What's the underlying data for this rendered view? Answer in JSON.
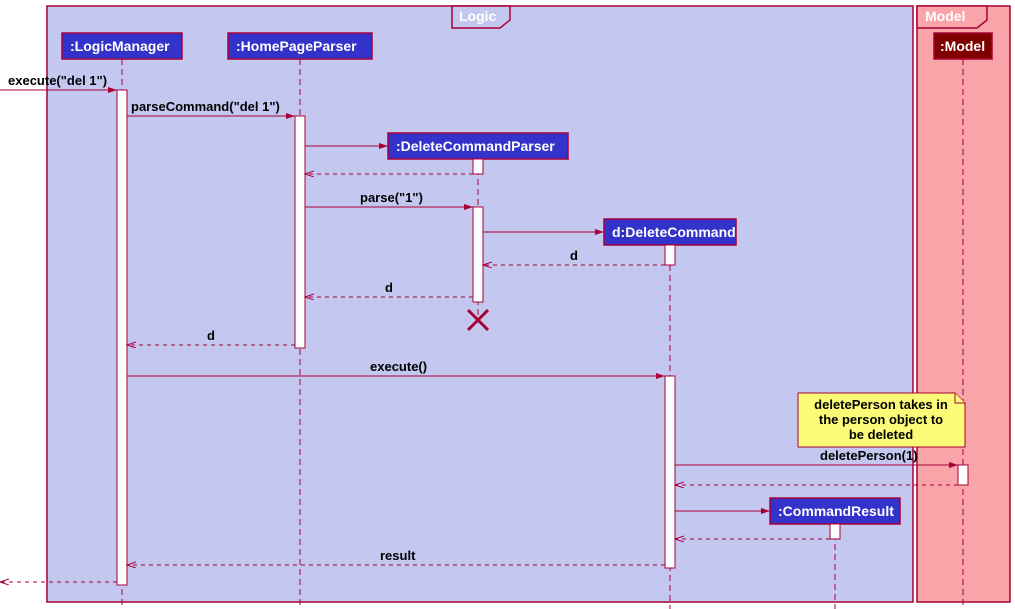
{
  "frames": {
    "logic": "Logic",
    "model": "Model"
  },
  "participants": {
    "logicManager": ":LogicManager",
    "homePageParser": ":HomePageParser",
    "deleteCommandParser": ":DeleteCommandParser",
    "deleteCommand": "d:DeleteCommand",
    "commandResult": ":CommandResult",
    "model": ":Model"
  },
  "messages": {
    "execute_in": "execute(\"del 1\")",
    "parseCommand": "parseCommand(\"del 1\")",
    "parse": "parse(\"1\")",
    "d_ret1": "d",
    "d_ret2": "d",
    "d_ret3": "d",
    "execute_call": "execute()",
    "deletePerson": "deletePerson(1)",
    "result": "result"
  },
  "note": {
    "line1": "deletePerson takes in",
    "line2": "the person object to",
    "line3": "be deleted"
  },
  "chart_data": {
    "type": "sequence-diagram",
    "frames": [
      {
        "name": "Logic",
        "contains": [
          ":LogicManager",
          ":HomePageParser",
          ":DeleteCommandParser",
          "d:DeleteCommand",
          ":CommandResult"
        ]
      },
      {
        "name": "Model",
        "contains": [
          ":Model"
        ]
      }
    ],
    "events": [
      {
        "from": "external",
        "to": ":LogicManager",
        "label": "execute(\"del 1\")",
        "type": "sync"
      },
      {
        "from": ":LogicManager",
        "to": ":HomePageParser",
        "label": "parseCommand(\"del 1\")",
        "type": "sync"
      },
      {
        "from": ":HomePageParser",
        "to": ":DeleteCommandParser",
        "label": "",
        "type": "create"
      },
      {
        "from": ":DeleteCommandParser",
        "to": ":HomePageParser",
        "label": "",
        "type": "return"
      },
      {
        "from": ":HomePageParser",
        "to": ":DeleteCommandParser",
        "label": "parse(\"1\")",
        "type": "sync"
      },
      {
        "from": ":DeleteCommandParser",
        "to": "d:DeleteCommand",
        "label": "",
        "type": "create"
      },
      {
        "from": "d:DeleteCommand",
        "to": ":DeleteCommandParser",
        "label": "d",
        "type": "return"
      },
      {
        "from": ":DeleteCommandParser",
        "to": ":HomePageParser",
        "label": "d",
        "type": "return"
      },
      {
        "type": "destroy",
        "target": ":DeleteCommandParser"
      },
      {
        "from": ":HomePageParser",
        "to": ":LogicManager",
        "label": "d",
        "type": "return"
      },
      {
        "from": ":LogicManager",
        "to": "d:DeleteCommand",
        "label": "execute()",
        "type": "sync"
      },
      {
        "type": "note",
        "attached_to": ":Model",
        "text": "deletePerson takes in the person object to be deleted"
      },
      {
        "from": "d:DeleteCommand",
        "to": ":Model",
        "label": "deletePerson(1)",
        "type": "sync"
      },
      {
        "from": ":Model",
        "to": "d:DeleteCommand",
        "label": "",
        "type": "return"
      },
      {
        "from": "d:DeleteCommand",
        "to": ":CommandResult",
        "label": "",
        "type": "create"
      },
      {
        "from": ":CommandResult",
        "to": "d:DeleteCommand",
        "label": "",
        "type": "return"
      },
      {
        "from": "d:DeleteCommand",
        "to": ":LogicManager",
        "label": "result",
        "type": "return"
      },
      {
        "from": ":LogicManager",
        "to": "external",
        "label": "",
        "type": "return"
      }
    ]
  }
}
